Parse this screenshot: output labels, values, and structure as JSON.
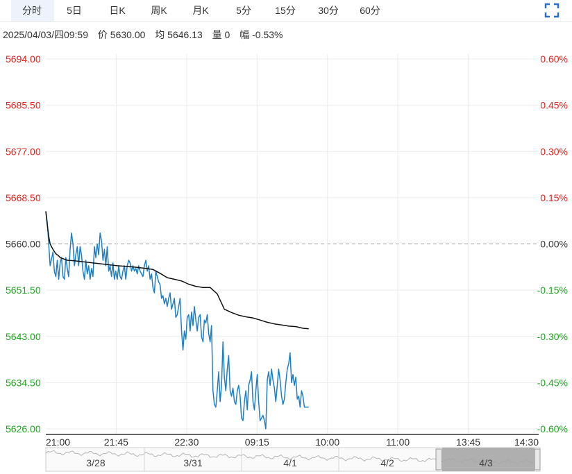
{
  "tabs": [
    "分时",
    "5日",
    "日K",
    "周K",
    "月K",
    "5分",
    "15分",
    "30分",
    "60分"
  ],
  "active_tab": "分时",
  "info": {
    "datetime": "2025/04/03/四09:59",
    "price": "价 5630.00",
    "avg": "均 5646.13",
    "volume": "量 0",
    "change": "幅 -0.53%"
  },
  "colors": {
    "price_line": "#1f7fc4",
    "avg_line": "#111111",
    "up": "#e0201b",
    "down": "#1aa51a",
    "flat": "#333333"
  },
  "chart_data": {
    "type": "line",
    "ylim": [
      5626.0,
      5694.0
    ],
    "prev_close": 5660.0,
    "y_ticks": [
      "5694.00",
      "5685.50",
      "5677.00",
      "5668.50",
      "5660.00",
      "5651.50",
      "5643.00",
      "5634.50",
      "5626.00"
    ],
    "pct_ticks": [
      "0.60%",
      "0.45%",
      "0.30%",
      "0.15%",
      "0.00%",
      "-0.15%",
      "-0.30%",
      "-0.45%",
      "-0.60%"
    ],
    "x_ticks": [
      "21:00",
      "21:45",
      "22:30",
      "09:15",
      "10:00",
      "11:00",
      "13:45",
      "14:30"
    ],
    "x_range": [
      0,
      345
    ],
    "series": [
      {
        "key": "price",
        "x": [
          0,
          1,
          3,
          5,
          6,
          7,
          8,
          9,
          10,
          11,
          12,
          13,
          14,
          15,
          16,
          17,
          18,
          19,
          20,
          21,
          22,
          23,
          24,
          25,
          26,
          27,
          28,
          29,
          30,
          31,
          32,
          33,
          34,
          35,
          36,
          37,
          38,
          39,
          40,
          41,
          42,
          43,
          44,
          45,
          46,
          47,
          48,
          49,
          50,
          51,
          52,
          53,
          54,
          55,
          56,
          57,
          58,
          59,
          60,
          61,
          62,
          63,
          64,
          65,
          66,
          67,
          68,
          69,
          70,
          71,
          72,
          73,
          74,
          75,
          76,
          77,
          78,
          79,
          80,
          81,
          82,
          83,
          84,
          85,
          86,
          87,
          88,
          89,
          90,
          91,
          92,
          93,
          94,
          95,
          96,
          97,
          98,
          99,
          100,
          101,
          102,
          103,
          104,
          105,
          106,
          107,
          108,
          109,
          110,
          111,
          112,
          113,
          114,
          115,
          116,
          117,
          118,
          119,
          120,
          121,
          122,
          123,
          124,
          125,
          126,
          127,
          128,
          129,
          130,
          131,
          132,
          133,
          134,
          135,
          136,
          137,
          138,
          139,
          140,
          141,
          142,
          143,
          144,
          145,
          146,
          147,
          148,
          149,
          150,
          151,
          152,
          153,
          154,
          155,
          156,
          157,
          158,
          159,
          160,
          161,
          162,
          163,
          164,
          165,
          166,
          167,
          168,
          169,
          170,
          171,
          172,
          173,
          174,
          175,
          176,
          177,
          178,
          179,
          180,
          181,
          182,
          183,
          184
        ],
        "y": [
          5666.0,
          5664.0,
          5656.0,
          5658.5,
          5655.0,
          5654.0,
          5657.0,
          5653.5,
          5656.5,
          5657.5,
          5654.0,
          5653.5,
          5657.5,
          5655.5,
          5654.0,
          5659.0,
          5662.0,
          5660.0,
          5656.0,
          5658.0,
          5659.5,
          5656.0,
          5659.5,
          5658.0,
          5655.0,
          5653.5,
          5657.0,
          5654.5,
          5656.0,
          5653.5,
          5655.5,
          5654.0,
          5659.5,
          5657.5,
          5660.0,
          5658.0,
          5662.0,
          5660.5,
          5657.0,
          5659.0,
          5656.0,
          5659.5,
          5655.0,
          5656.0,
          5654.0,
          5656.5,
          5653.5,
          5655.0,
          5653.5,
          5656.0,
          5654.0,
          5653.5,
          5655.0,
          5656.0,
          5653.5,
          5656.0,
          5657.0,
          5656.5,
          5655.0,
          5656.0,
          5655.0,
          5655.5,
          5654.5,
          5656.0,
          5655.0,
          5654.5,
          5654.0,
          5656.0,
          5657.0,
          5655.0,
          5656.0,
          5653.5,
          5654.5,
          5652.0,
          5651.0,
          5655.0,
          5654.0,
          5653.0,
          5652.5,
          5650.0,
          5650.5,
          5649.0,
          5650.0,
          5648.5,
          5650.0,
          5651.0,
          5648.0,
          5649.0,
          5650.0,
          5646.5,
          5647.0,
          5648.5,
          5650.0,
          5644.0,
          5640.5,
          5644.0,
          5642.5,
          5646.5,
          5647.0,
          5644.0,
          5647.5,
          5645.0,
          5648.5,
          5646.0,
          5644.0,
          5646.5,
          5647.0,
          5643.0,
          5642.0,
          5646.0,
          5645.5,
          5647.0,
          5643.5,
          5642.0,
          5645.0,
          5633.0,
          5630.5,
          5630.0,
          5633.0,
          5636.5,
          5631.0,
          5634.0,
          5642.0,
          5635.5,
          5633.0,
          5637.0,
          5639.5,
          5633.0,
          5632.0,
          5633.5,
          5631.0,
          5630.5,
          5633.0,
          5634.0,
          5632.0,
          5628.0,
          5627.5,
          5631.0,
          5633.0,
          5629.5,
          5634.0,
          5635.0,
          5636.5,
          5631.0,
          5629.5,
          5633.0,
          5636.0,
          5631.0,
          5627.5,
          5628.0,
          5628.5,
          5627.5,
          5626.0,
          5635.0,
          5636.5,
          5634.0,
          5637.0,
          5635.0,
          5633.5,
          5631.0,
          5634.0,
          5637.0,
          5635.0,
          5632.0,
          5630.5,
          5631.5,
          5634.5,
          5637.0,
          5638.0,
          5640.0,
          5634.5,
          5636.0,
          5634.0,
          5635.5,
          5631.5,
          5632.0,
          5630.0,
          5633.0,
          5632.0,
          5630.0,
          5630.0,
          5630.0,
          5630.0
        ]
      },
      {
        "key": "avg",
        "x": [
          0,
          1,
          2,
          3,
          4,
          5,
          7,
          9,
          10,
          12,
          15,
          20,
          30,
          40,
          50,
          60,
          70,
          75,
          80,
          85,
          90,
          95,
          100,
          105,
          110,
          115,
          120,
          125,
          130,
          135,
          140,
          145,
          150,
          155,
          160,
          165,
          170,
          175,
          180,
          184
        ],
        "y": [
          5666.0,
          5663.5,
          5661.5,
          5660.0,
          5659.5,
          5659.0,
          5658.2,
          5657.8,
          5657.5,
          5657.3,
          5657.0,
          5656.9,
          5656.6,
          5656.3,
          5656.0,
          5655.8,
          5655.5,
          5655.3,
          5654.6,
          5653.8,
          5653.5,
          5653.2,
          5652.6,
          5652.2,
          5652.0,
          5652.0,
          5650.8,
          5648.0,
          5647.4,
          5646.9,
          5646.6,
          5646.4,
          5646.0,
          5645.6,
          5645.3,
          5645.1,
          5644.9,
          5644.8,
          5644.5,
          5644.4
        ]
      }
    ]
  },
  "navigator": {
    "labels": [
      "3/28",
      "3/31",
      "4/1",
      "4/2",
      "4/3"
    ]
  }
}
